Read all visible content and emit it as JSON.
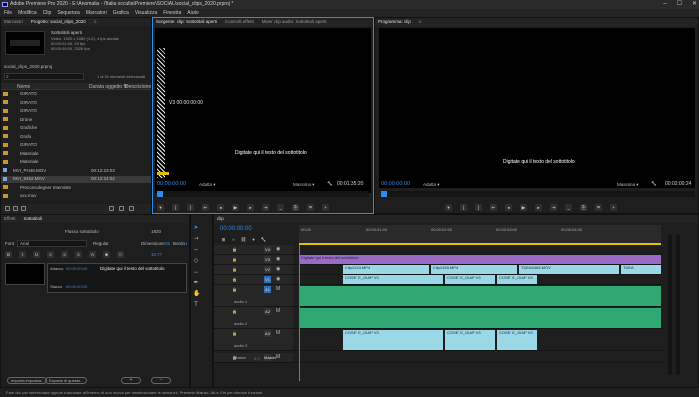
{
  "app_title": "Adobe Premiere Pro 2020 - E:\\Anomalia - l'Italia occulta\\Premiere\\SOCIAL\\social_clips_2020.prproj *",
  "menu": [
    "File",
    "Modifica",
    "Clip",
    "Sequenza",
    "Marcatori",
    "Grafica",
    "Visualizza",
    "Finestra",
    "Aiuto"
  ],
  "project_panel": {
    "tabs": [
      "Marcatori",
      "Progetto: social_clips_2020",
      "≡"
    ],
    "preview_name": "Sottotitoli aperti",
    "preview_info": [
      "Video, 1920 x 1080 (1,0), 4 fps durata:",
      "00:00:01:00, 25 fps",
      "00:00:00:00, 2026 fps"
    ],
    "project_file": "social_clips_2020.prproj",
    "search_placeholder": "",
    "selection_info": "1 di 31 elementi selezionati",
    "col_name": "Nome",
    "col_speed": "Durata oggetto ftr",
    "col_desc": "Descrizione",
    "items": [
      {
        "name": "GIRATO",
        "type": "folder",
        "duration": ""
      },
      {
        "name": "GIRATO",
        "type": "folder",
        "duration": ""
      },
      {
        "name": "GIRATO",
        "type": "folder",
        "duration": ""
      },
      {
        "name": "Drone",
        "type": "folder",
        "duration": ""
      },
      {
        "name": "Grafiche",
        "type": "folder",
        "duration": ""
      },
      {
        "name": "Grafo",
        "type": "folder",
        "duration": ""
      },
      {
        "name": "GIRATO",
        "type": "folder",
        "duration": ""
      },
      {
        "name": "Materiale",
        "type": "folder",
        "duration": ""
      },
      {
        "name": "Materiale",
        "type": "folder",
        "duration": ""
      },
      {
        "name": "MVI_PH48.MOV",
        "type": "clip",
        "duration": "00:12:23:03"
      },
      {
        "name": "MVI_9452.MOV",
        "type": "clip",
        "duration": "00:12:24:02"
      },
      {
        "name": "Preconsolegner Interviste",
        "type": "folder",
        "duration": ""
      },
      {
        "name": "xxx.mov",
        "type": "folder",
        "duration": ""
      }
    ]
  },
  "source_monitor": {
    "tabs": [
      "Sorgente: clip: Sottotitoli aperti",
      "Controlli effetti",
      "Mixer clip audio: Sottotitoli aperti"
    ],
    "overlay_timecode": "V3 00:00:00:00",
    "subtitle": "Digitate qui il testo del sottotitolo",
    "timecode": "00:00:00:00",
    "fit": "Adatta",
    "quality": "Massima",
    "duration": "00:01:35:20"
  },
  "program_monitor": {
    "tabs": [
      "Programma: clip",
      "≡"
    ],
    "subtitle": "Digitate qui il testo del sottotitolo",
    "timecode": "00:00:00:00",
    "fit": "Adatta",
    "quality": "Massima",
    "duration": "00:02:00:24"
  },
  "captions_panel": {
    "tabs": [
      "Effetti",
      "Sottotitoli"
    ],
    "stream_label": "Flusso sottotitolo",
    "stream_value": "1920",
    "font_label": "Font",
    "font_value": "Arial",
    "style_value": "Regular",
    "size_label": "Dimensione",
    "size_value": "35",
    "edge_label": "Bordo",
    "edge_value": "1",
    "position_value": "10,77",
    "in_label": "Attacco",
    "in_value": "00:00:00:00",
    "out_label": "Stacco",
    "out_value": "00:00:00:00",
    "caption_text": "Digitate qui il testo del sottotitolo",
    "import_button": "Importa impostaz.",
    "export_button": "Esporta di questo..."
  },
  "timeline": {
    "tab": "clip",
    "timecode": "00:00:00:00",
    "ruler_ticks": [
      "00:00",
      "00:00:01:00",
      "00:00:02:00",
      "00:00:03:00",
      "00:00:04:00"
    ],
    "tracks": [
      {
        "id": "V4",
        "label": ""
      },
      {
        "id": "V3",
        "label": ""
      },
      {
        "id": "V2",
        "label": ""
      },
      {
        "id": "V1",
        "label": ""
      },
      {
        "id": "A1",
        "label": "audio 1"
      },
      {
        "id": "A2",
        "label": "audio 2"
      },
      {
        "id": "A3",
        "label": "audio 3"
      },
      {
        "id": "Master",
        "label": "Master"
      }
    ],
    "subtitle_clip": "Digitate qui il testo del sottotitolo",
    "v2_clips": [
      "Clip1234.MP4",
      "Clip1345.MP4",
      "TDEA0466.MOV",
      "TDEA"
    ],
    "v1_clips": [
      "COSE' E_GIAP V3",
      "COSE' E_GIAP V3",
      "COSE' E_GIAP V3"
    ],
    "a3_clips": [
      "COSE' E_GIAP V3",
      "COSE' E_GIAP V3",
      "COSE' E_GIAP V3"
    ],
    "master_value": "0,0"
  },
  "status_bar": "Fare clic per selezionare oppure trascinate all'interno di una nuova per deselezionare le selezioni. Premete Maiusc, Alt e Ctrl per ulteriori funzioni.",
  "colors": {
    "accent": "#2d8ceb",
    "folder": "#c8982e",
    "clip_cyan": "#9ad8e8",
    "audio_green": "#2fa874",
    "subtitle_purple": "#9a6ac8"
  }
}
